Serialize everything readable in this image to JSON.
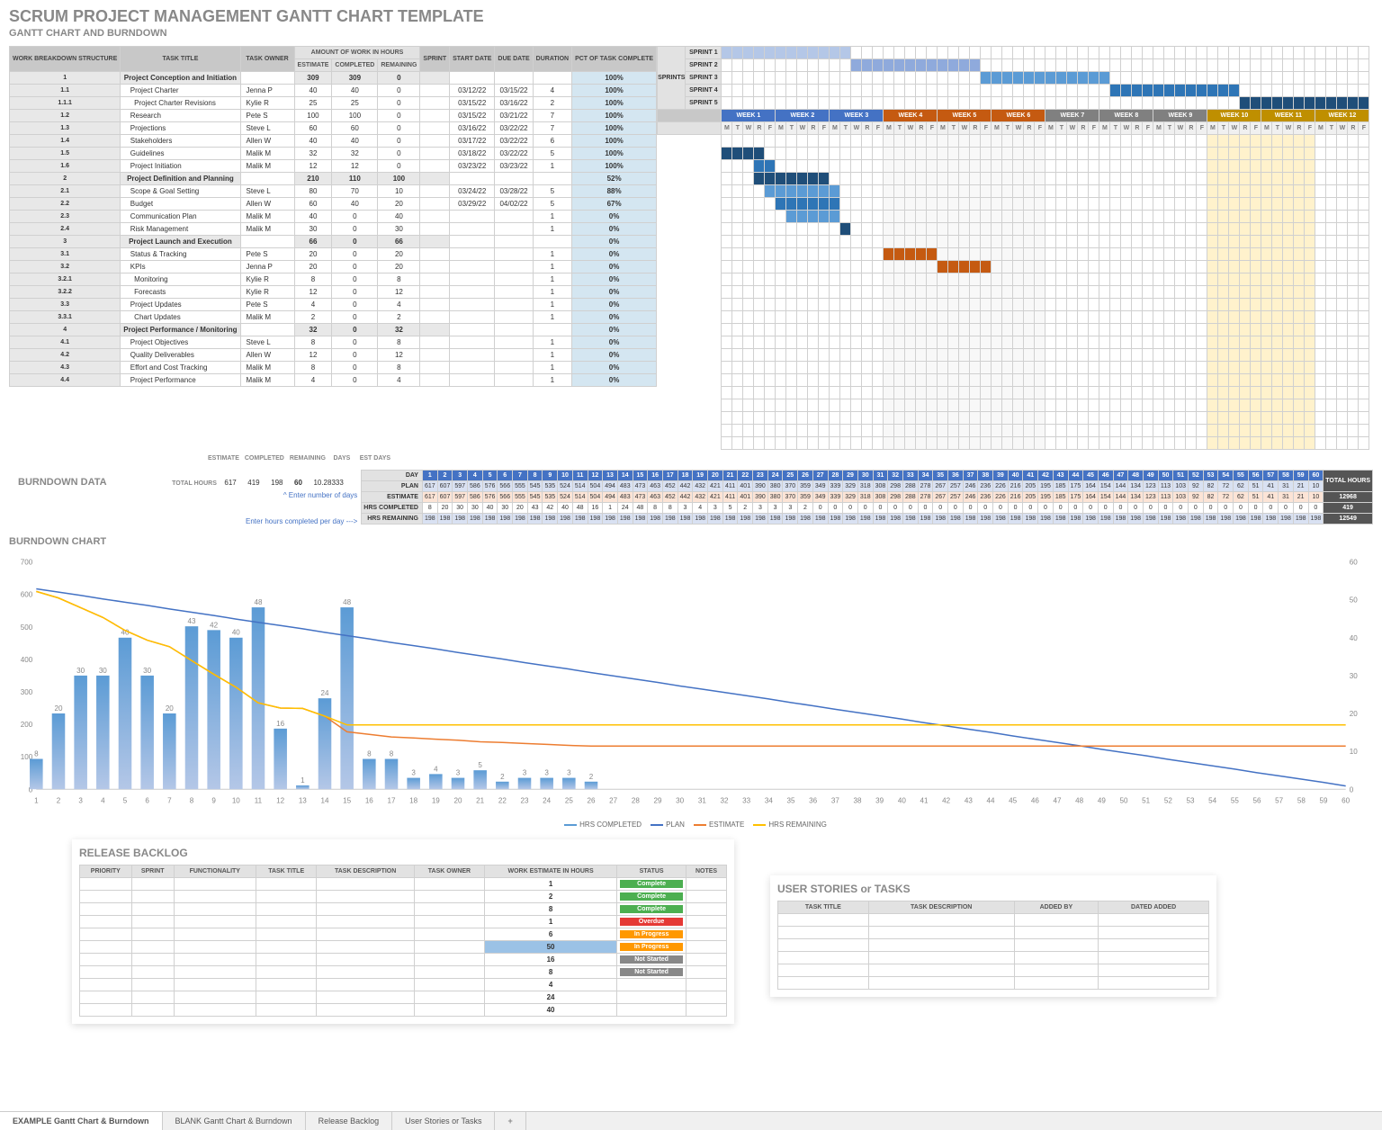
{
  "title": "SCRUM PROJECT MANAGEMENT GANTT CHART TEMPLATE",
  "subtitle": "GANTT CHART AND BURNDOWN",
  "headers": {
    "wbs": "WORK BREAKDOWN STRUCTURE",
    "task": "TASK TITLE",
    "owner": "TASK OWNER",
    "amount": "AMOUNT OF WORK IN HOURS",
    "est": "ESTIMATE",
    "comp": "COMPLETED",
    "rem": "REMAINING",
    "sprint": "SPRINT",
    "start": "START DATE",
    "due": "DUE DATE",
    "dur": "DURATION",
    "pct": "PCT OF TASK COMPLETE",
    "sprints_label": "SPRINTS"
  },
  "sprints": [
    "SPRINT 1",
    "SPRINT 2",
    "SPRINT 3",
    "SPRINT 4",
    "SPRINT 5"
  ],
  "sprint_colors": [
    "#b4c7e7",
    "#8faadc",
    "#5b9bd5",
    "#2e75b6",
    "#1f4e79"
  ],
  "weeks": [
    {
      "label": "WEEK 1",
      "color": "#4472C4"
    },
    {
      "label": "WEEK 2",
      "color": "#4472C4"
    },
    {
      "label": "WEEK 3",
      "color": "#4472C4"
    },
    {
      "label": "WEEK 4",
      "color": "#C55A11"
    },
    {
      "label": "WEEK 5",
      "color": "#C55A11"
    },
    {
      "label": "WEEK 6",
      "color": "#C55A11"
    },
    {
      "label": "WEEK 7",
      "color": "#808080"
    },
    {
      "label": "WEEK 8",
      "color": "#808080"
    },
    {
      "label": "WEEK 9",
      "color": "#808080"
    },
    {
      "label": "WEEK 10",
      "color": "#BF8F00"
    },
    {
      "label": "WEEK 11",
      "color": "#BF8F00"
    },
    {
      "label": "WEEK 12",
      "color": "#BF8F00"
    }
  ],
  "day_letters": [
    "M",
    "T",
    "W",
    "R",
    "F"
  ],
  "tasks": [
    {
      "wbs": "1",
      "title": "Project Conception and Initiation",
      "owner": "",
      "est": 309,
      "comp": 309,
      "rem": 0,
      "sprint": "",
      "start": "",
      "due": "",
      "dur": "",
      "pct": "100%",
      "sum": true
    },
    {
      "wbs": "1.1",
      "title": "Project Charter",
      "owner": "Jenna P",
      "est": 40,
      "comp": 40,
      "rem": 0,
      "sprint": "",
      "start": "03/12/22",
      "due": "03/15/22",
      "dur": 4,
      "pct": "100%",
      "bar": [
        0,
        4
      ],
      "color": "#1f4e79"
    },
    {
      "wbs": "1.1.1",
      "title": "Project Charter Revisions",
      "owner": "Kylie R",
      "est": 25,
      "comp": 25,
      "rem": 0,
      "sprint": "",
      "start": "03/15/22",
      "due": "03/16/22",
      "dur": 2,
      "pct": "100%",
      "bar": [
        3,
        2
      ],
      "color": "#2e75b6"
    },
    {
      "wbs": "1.2",
      "title": "Research",
      "owner": "Pete S",
      "est": 100,
      "comp": 100,
      "rem": 0,
      "sprint": "",
      "start": "03/15/22",
      "due": "03/21/22",
      "dur": 7,
      "pct": "100%",
      "bar": [
        3,
        7
      ],
      "color": "#1f4e79"
    },
    {
      "wbs": "1.3",
      "title": "Projections",
      "owner": "Steve L",
      "est": 60,
      "comp": 60,
      "rem": 0,
      "sprint": "",
      "start": "03/16/22",
      "due": "03/22/22",
      "dur": 7,
      "pct": "100%",
      "bar": [
        4,
        7
      ],
      "color": "#5b9bd5"
    },
    {
      "wbs": "1.4",
      "title": "Stakeholders",
      "owner": "Allen W",
      "est": 40,
      "comp": 40,
      "rem": 0,
      "sprint": "",
      "start": "03/17/22",
      "due": "03/22/22",
      "dur": 6,
      "pct": "100%",
      "bar": [
        5,
        6
      ],
      "color": "#2e75b6"
    },
    {
      "wbs": "1.5",
      "title": "Guidelines",
      "owner": "Malik M",
      "est": 32,
      "comp": 32,
      "rem": 0,
      "sprint": "",
      "start": "03/18/22",
      "due": "03/22/22",
      "dur": 5,
      "pct": "100%",
      "bar": [
        6,
        5
      ],
      "color": "#5b9bd5"
    },
    {
      "wbs": "1.6",
      "title": "Project Initiation",
      "owner": "Malik M",
      "est": 12,
      "comp": 12,
      "rem": 0,
      "sprint": "",
      "start": "03/23/22",
      "due": "03/23/22",
      "dur": 1,
      "pct": "100%",
      "bar": [
        11,
        1
      ],
      "color": "#1f4e79"
    },
    {
      "wbs": "2",
      "title": "Project Definition and Planning",
      "owner": "",
      "est": 210,
      "comp": 110,
      "rem": 100,
      "sprint": "",
      "start": "",
      "due": "",
      "dur": "",
      "pct": "52%",
      "sum": true
    },
    {
      "wbs": "2.1",
      "title": "Scope & Goal Setting",
      "owner": "Steve L",
      "est": 80,
      "comp": 70,
      "rem": 10,
      "sprint": "",
      "start": "03/24/22",
      "due": "03/28/22",
      "dur": 5,
      "pct": "88%",
      "bar": [
        15,
        5
      ],
      "color": "#C55A11"
    },
    {
      "wbs": "2.2",
      "title": "Budget",
      "owner": "Allen W",
      "est": 60,
      "comp": 40,
      "rem": 20,
      "sprint": "",
      "start": "03/29/22",
      "due": "04/02/22",
      "dur": 5,
      "pct": "67%",
      "bar": [
        20,
        5
      ],
      "color": "#C55A11"
    },
    {
      "wbs": "2.3",
      "title": "Communication Plan",
      "owner": "Malik M",
      "est": 40,
      "comp": 0,
      "rem": 40,
      "sprint": "",
      "start": "",
      "due": "",
      "dur": 1,
      "pct": "0%"
    },
    {
      "wbs": "2.4",
      "title": "Risk Management",
      "owner": "Malik M",
      "est": 30,
      "comp": 0,
      "rem": 30,
      "sprint": "",
      "start": "",
      "due": "",
      "dur": 1,
      "pct": "0%"
    },
    {
      "wbs": "3",
      "title": "Project Launch and Execution",
      "owner": "",
      "est": 66,
      "comp": 0,
      "rem": 66,
      "sprint": "",
      "start": "",
      "due": "",
      "dur": "",
      "pct": "0%",
      "sum": true
    },
    {
      "wbs": "3.1",
      "title": "Status & Tracking",
      "owner": "Pete S",
      "est": 20,
      "comp": 0,
      "rem": 20,
      "sprint": "",
      "start": "",
      "due": "",
      "dur": 1,
      "pct": "0%"
    },
    {
      "wbs": "3.2",
      "title": "KPIs",
      "owner": "Jenna P",
      "est": 20,
      "comp": 0,
      "rem": 20,
      "sprint": "",
      "start": "",
      "due": "",
      "dur": 1,
      "pct": "0%"
    },
    {
      "wbs": "3.2.1",
      "title": "Monitoring",
      "owner": "Kylie R",
      "est": 8,
      "comp": 0,
      "rem": 8,
      "sprint": "",
      "start": "",
      "due": "",
      "dur": 1,
      "pct": "0%"
    },
    {
      "wbs": "3.2.2",
      "title": "Forecasts",
      "owner": "Kylie R",
      "est": 12,
      "comp": 0,
      "rem": 12,
      "sprint": "",
      "start": "",
      "due": "",
      "dur": 1,
      "pct": "0%"
    },
    {
      "wbs": "3.3",
      "title": "Project Updates",
      "owner": "Pete S",
      "est": 4,
      "comp": 0,
      "rem": 4,
      "sprint": "",
      "start": "",
      "due": "",
      "dur": 1,
      "pct": "0%"
    },
    {
      "wbs": "3.3.1",
      "title": "Chart Updates",
      "owner": "Malik M",
      "est": 2,
      "comp": 0,
      "rem": 2,
      "sprint": "",
      "start": "",
      "due": "",
      "dur": 1,
      "pct": "0%"
    },
    {
      "wbs": "4",
      "title": "Project Performance / Monitoring",
      "owner": "",
      "est": 32,
      "comp": 0,
      "rem": 32,
      "sprint": "",
      "start": "",
      "due": "",
      "dur": "",
      "pct": "0%",
      "sum": true
    },
    {
      "wbs": "4.1",
      "title": "Project Objectives",
      "owner": "Steve L",
      "est": 8,
      "comp": 0,
      "rem": 8,
      "sprint": "",
      "start": "",
      "due": "",
      "dur": 1,
      "pct": "0%"
    },
    {
      "wbs": "4.2",
      "title": "Quality Deliverables",
      "owner": "Allen W",
      "est": 12,
      "comp": 0,
      "rem": 12,
      "sprint": "",
      "start": "",
      "due": "",
      "dur": 1,
      "pct": "0%"
    },
    {
      "wbs": "4.3",
      "title": "Effort and Cost Tracking",
      "owner": "Malik M",
      "est": 8,
      "comp": 0,
      "rem": 8,
      "sprint": "",
      "start": "",
      "due": "",
      "dur": 1,
      "pct": "0%"
    },
    {
      "wbs": "4.4",
      "title": "Project Performance",
      "owner": "Malik M",
      "est": 4,
      "comp": 0,
      "rem": 4,
      "sprint": "",
      "start": "",
      "due": "",
      "dur": 1,
      "pct": "0%"
    }
  ],
  "totals": {
    "labels": {
      "est": "ESTIMATE",
      "comp": "COMPLETED",
      "rem": "REMAINING",
      "days": "DAYS",
      "estdays": "EST DAYS",
      "total_hours": "TOTAL HOURS"
    },
    "est": 617,
    "comp": 419,
    "rem": 198,
    "days": 60,
    "estdays": "10.28333"
  },
  "hints": {
    "days": "^ Enter number of days",
    "completed": "Enter hours completed per day --->"
  },
  "burndown_section": "BURNDOWN DATA",
  "burndown_headers": {
    "day": "DAY",
    "plan": "PLAN",
    "est": "ESTIMATE",
    "comp": "HRS COMPLETED",
    "rem": "HRS REMAINING",
    "total": "TOTAL HOURS"
  },
  "burndown": {
    "days": 60,
    "plan": [
      617,
      607,
      597,
      586,
      576,
      566,
      555,
      545,
      535,
      524,
      514,
      504,
      494,
      483,
      473,
      463,
      452,
      442,
      432,
      421,
      411,
      401,
      390,
      380,
      370,
      359,
      349,
      339,
      329,
      318,
      308,
      298,
      288,
      278,
      267,
      257,
      246,
      236,
      226,
      216,
      205,
      195,
      185,
      175,
      164,
      154,
      144,
      134,
      123,
      113,
      103,
      92,
      82,
      72,
      62,
      51,
      41,
      31,
      21,
      10
    ],
    "est": [
      617,
      607,
      597,
      586,
      576,
      566,
      555,
      545,
      535,
      524,
      514,
      504,
      494,
      483,
      473,
      463,
      452,
      442,
      432,
      421,
      411,
      401,
      390,
      380,
      370,
      359,
      349,
      339,
      329,
      318,
      308,
      298,
      288,
      278,
      267,
      257,
      246,
      236,
      226,
      216,
      205,
      195,
      185,
      175,
      164,
      154,
      144,
      134,
      123,
      113,
      103,
      92,
      82,
      72,
      62,
      51,
      41,
      31,
      21,
      10
    ],
    "comp": [
      8,
      20,
      30,
      30,
      40,
      30,
      20,
      43,
      42,
      40,
      48,
      16,
      1,
      24,
      48,
      8,
      8,
      3,
      4,
      3,
      5,
      2,
      3,
      3,
      3,
      2,
      0,
      0,
      0,
      0,
      0,
      0,
      0,
      0,
      0,
      0,
      0,
      0,
      0,
      0,
      0,
      0,
      0,
      0,
      0,
      0,
      0,
      0,
      0,
      0,
      0,
      0,
      0,
      0,
      0,
      0,
      0,
      0,
      0,
      0
    ],
    "totals": {
      "est": 12968,
      "comp": 419,
      "rem": 12549
    }
  },
  "chart_section": "BURNDOWN CHART",
  "chart_data": {
    "type": "combo",
    "x": [
      1,
      2,
      3,
      4,
      5,
      6,
      7,
      8,
      9,
      10,
      11,
      12,
      13,
      14,
      15,
      16,
      17,
      18,
      19,
      20,
      21,
      22,
      23,
      24,
      25,
      26,
      27,
      28,
      29,
      30,
      31,
      32,
      33,
      34,
      35,
      36,
      37,
      38,
      39,
      40,
      41,
      42,
      43,
      44,
      45,
      46,
      47,
      48,
      49,
      50,
      51,
      52,
      53,
      54,
      55,
      56,
      57,
      58,
      59,
      60
    ],
    "series": [
      {
        "name": "HRS COMPLETED",
        "type": "bar",
        "axis": "right",
        "values": [
          8,
          20,
          30,
          30,
          40,
          30,
          20,
          43,
          42,
          40,
          48,
          16,
          1,
          24,
          48,
          8,
          8,
          3,
          4,
          3,
          5,
          2,
          3,
          3,
          3,
          2,
          0,
          0,
          0,
          0,
          0,
          0,
          0,
          0,
          0,
          0,
          0,
          0,
          0,
          0,
          0,
          0,
          0,
          0,
          0,
          0,
          0,
          0,
          0,
          0,
          0,
          0,
          0,
          0,
          0,
          0,
          0,
          0,
          0,
          0
        ],
        "color": "#5b9bd5"
      },
      {
        "name": "PLAN",
        "type": "line",
        "axis": "left",
        "values": [
          617,
          607,
          597,
          586,
          576,
          566,
          555,
          545,
          535,
          524,
          514,
          504,
          494,
          483,
          473,
          463,
          452,
          442,
          432,
          421,
          411,
          401,
          390,
          380,
          370,
          359,
          349,
          339,
          329,
          318,
          308,
          298,
          288,
          278,
          267,
          257,
          246,
          236,
          226,
          216,
          205,
          195,
          185,
          175,
          164,
          154,
          144,
          134,
          123,
          113,
          103,
          92,
          82,
          72,
          62,
          51,
          41,
          31,
          21,
          10
        ],
        "color": "#4472C4"
      },
      {
        "name": "ESTIMATE",
        "type": "line",
        "axis": "left",
        "values": [
          609,
          589,
          559,
          529,
          489,
          459,
          439,
          396,
          354,
          314,
          266,
          250,
          249,
          225,
          177,
          169,
          161,
          158,
          154,
          151,
          146,
          144,
          141,
          138,
          135,
          133,
          133,
          133,
          133,
          133,
          133,
          133,
          133,
          133,
          133,
          133,
          133,
          133,
          133,
          133,
          133,
          133,
          133,
          133,
          133,
          133,
          133,
          133,
          133,
          133,
          133,
          133,
          133,
          133,
          133,
          133,
          133,
          133,
          133,
          133
        ],
        "color": "#ED7D31"
      },
      {
        "name": "HRS REMAINING",
        "type": "line",
        "axis": "left",
        "values": [
          609,
          589,
          559,
          529,
          489,
          459,
          439,
          396,
          354,
          314,
          266,
          250,
          249,
          225,
          198,
          198,
          198,
          198,
          198,
          198,
          198,
          198,
          198,
          198,
          198,
          198,
          198,
          198,
          198,
          198,
          198,
          198,
          198,
          198,
          198,
          198,
          198,
          198,
          198,
          198,
          198,
          198,
          198,
          198,
          198,
          198,
          198,
          198,
          198,
          198,
          198,
          198,
          198,
          198,
          198,
          198,
          198,
          198,
          198,
          198
        ],
        "color": "#FFC000"
      }
    ],
    "ylim_left": [
      0,
      700
    ],
    "ylim_right": [
      0,
      60
    ],
    "yticks_left": [
      0,
      100,
      200,
      300,
      400,
      500,
      600,
      700
    ],
    "yticks_right": [
      0,
      10,
      20,
      30,
      40,
      50,
      60
    ],
    "legend": [
      "HRS COMPLETED",
      "PLAN",
      "ESTIMATE",
      "HRS REMAINING"
    ]
  },
  "backlog": {
    "title": "RELEASE BACKLOG",
    "headers": [
      "PRIORITY",
      "SPRINT",
      "FUNCTIONALITY",
      "TASK TITLE",
      "TASK DESCRIPTION",
      "TASK OWNER",
      "WORK ESTIMATE IN HOURS",
      "STATUS",
      "NOTES"
    ],
    "rows": [
      {
        "hrs": "1",
        "status": "Complete",
        "cls": "st-comp"
      },
      {
        "hrs": "2",
        "status": "Complete",
        "cls": "st-comp"
      },
      {
        "hrs": "8",
        "status": "Complete",
        "cls": "st-comp"
      },
      {
        "hrs": "1",
        "status": "Overdue",
        "cls": "st-over"
      },
      {
        "hrs": "6",
        "status": "In Progress",
        "cls": "st-prog"
      },
      {
        "hrs": "50",
        "status": "In Progress",
        "cls": "st-prog",
        "hilite": true
      },
      {
        "hrs": "16",
        "status": "Not Started",
        "cls": "st-not"
      },
      {
        "hrs": "8",
        "status": "Not Started",
        "cls": "st-not"
      },
      {
        "hrs": "4",
        "status": "",
        "cls": ""
      },
      {
        "hrs": "24",
        "status": "",
        "cls": ""
      },
      {
        "hrs": "40",
        "status": "",
        "cls": ""
      }
    ]
  },
  "stories": {
    "title": "USER STORIES or TASKS",
    "headers": [
      "TASK TITLE",
      "TASK DESCRIPTION",
      "ADDED BY",
      "DATED ADDED"
    ]
  },
  "tabs": [
    "EXAMPLE Gantt Chart & Burndown",
    "BLANK Gantt Chart & Burndown",
    "Release Backlog",
    "User Stories or Tasks"
  ]
}
